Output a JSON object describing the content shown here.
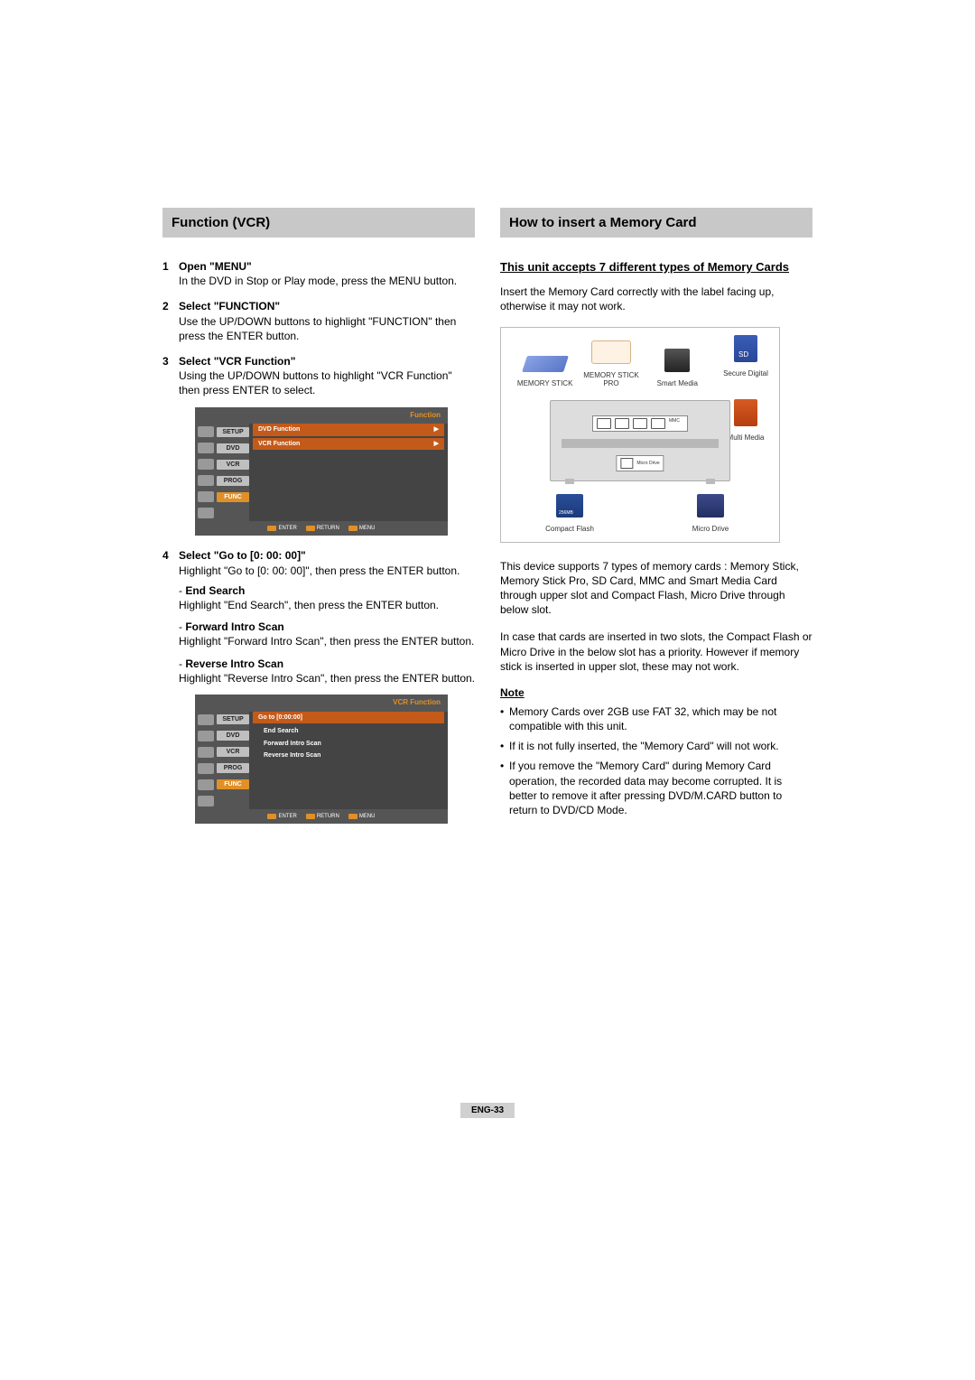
{
  "left": {
    "header": "Function (VCR)",
    "steps": {
      "s1": {
        "title": "Open \"MENU\"",
        "body": "In the DVD in Stop or Play mode, press the MENU button."
      },
      "s2": {
        "title": "Select \"FUNCTION\"",
        "body": "Use the UP/DOWN buttons to highlight \"FUNCTION\" then press the ENTER button."
      },
      "s3": {
        "title": "Select \"VCR Function\"",
        "body": "Using the UP/DOWN buttons to highlight \"VCR Function\"  then press ENTER to select."
      },
      "s4": {
        "title": "Select \"Go to [0: 00: 00]\"",
        "body": "Highlight \"Go to [0: 00: 00]\", then press the ENTER button.",
        "subs": [
          {
            "label": "End Search",
            "body": "Highlight \"End Search\", then press the ENTER button."
          },
          {
            "label": "Forward Intro Scan",
            "body": "Highlight \"Forward Intro Scan\", then press the ENTER button."
          },
          {
            "label": "Reverse Intro Scan",
            "body": "Highlight \"Reverse Intro Scan\", then press the ENTER button."
          }
        ]
      }
    },
    "osd1": {
      "title": "Function",
      "sidebar": [
        "SETUP",
        "DVD",
        "VCR",
        "PROG",
        "FUNC"
      ],
      "items": [
        "DVD Function",
        "VCR Function"
      ],
      "buttons": [
        "ENTER",
        "RETURN",
        "MENU"
      ]
    },
    "osd2": {
      "title": "VCR Function",
      "sidebar": [
        "SETUP",
        "DVD",
        "VCR",
        "PROG",
        "FUNC"
      ],
      "items": [
        "Go to [0:00:00]",
        "End Search",
        "Forward Intro Scan",
        "Reverse Intro Scan"
      ],
      "buttons": [
        "ENTER",
        "RETURN",
        "MENU"
      ]
    }
  },
  "right": {
    "header": "How to insert a Memory Card",
    "subheading": "This unit accepts 7 different types of Memory Cards",
    "intro": "Insert the Memory Card correctly with the label facing up, otherwise it may not work.",
    "cards": {
      "ms": "MEMORY STICK",
      "msp": "MEMORY STICK PRO",
      "sm": "Smart Media",
      "sd": "Secure Digital",
      "mm": "Multi Media",
      "cf": "Compact Flash",
      "md": "Micro Drive",
      "slot_label": "Micro Drive"
    },
    "p1": "This device supports 7 types of memory cards : Memory Stick, Memory Stick Pro, SD Card, MMC and Smart Media Card through upper slot and Compact Flash, Micro Drive through below slot.",
    "p2": "In case that cards are inserted in two slots, the Compact Flash or Micro Drive in the below slot has a priority. However if memory stick is inserted in upper slot, these may not work.",
    "noteHeading": "Note",
    "notes": [
      "Memory Cards over 2GB use FAT 32, which may be not compatible with this unit.",
      "If it is not fully inserted, the \"Memory Card\" will not work.",
      "If you remove the \"Memory Card\" during Memory Card operation, the recorded data may become corrupted. It is better to remove it after pressing DVD/M.CARD button to return to DVD/CD Mode."
    ]
  },
  "footer": "ENG-33"
}
